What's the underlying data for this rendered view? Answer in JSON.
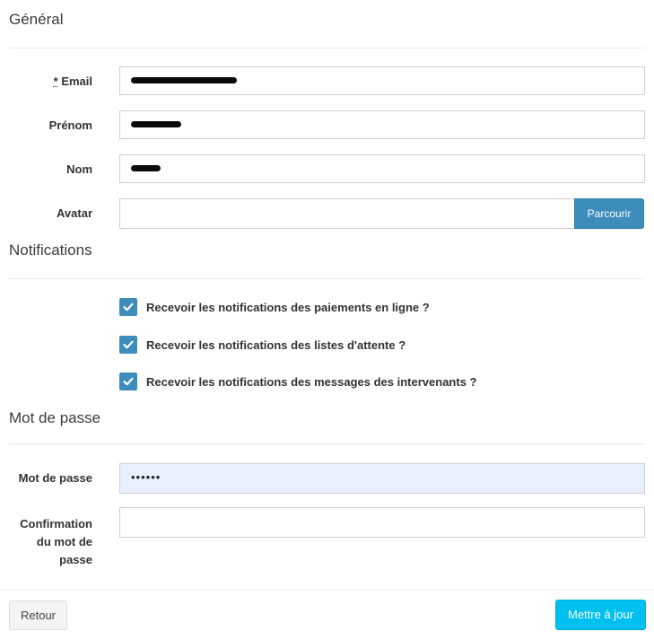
{
  "sections": {
    "general": "Général",
    "notifications": "Notifications",
    "password": "Mot de passe"
  },
  "fields": {
    "email": {
      "required_mark": "*",
      "label": "Email"
    },
    "firstname": {
      "label": "Prénom"
    },
    "lastname": {
      "label": "Nom"
    },
    "avatar": {
      "label": "Avatar",
      "browse_label": "Parcourir"
    },
    "password": {
      "label": "Mot de passe",
      "value": "••••••"
    },
    "password_confirm": {
      "label_line1": "Confirmation",
      "label_line2": "du mot de",
      "label_line3": "passe"
    }
  },
  "notifications": [
    {
      "label": "Recevoir les notifications des paiements en ligne ?",
      "checked": true
    },
    {
      "label": "Recevoir les notifications des listes d'attente ?",
      "checked": true
    },
    {
      "label": "Recevoir les notifications des messages des intervenants ?",
      "checked": true
    }
  ],
  "actions": {
    "back": "Retour",
    "update": "Mettre à jour"
  },
  "colors": {
    "primary": "#3c8dbc",
    "info": "#00c0ef",
    "highlight": "#e8f0fe"
  }
}
